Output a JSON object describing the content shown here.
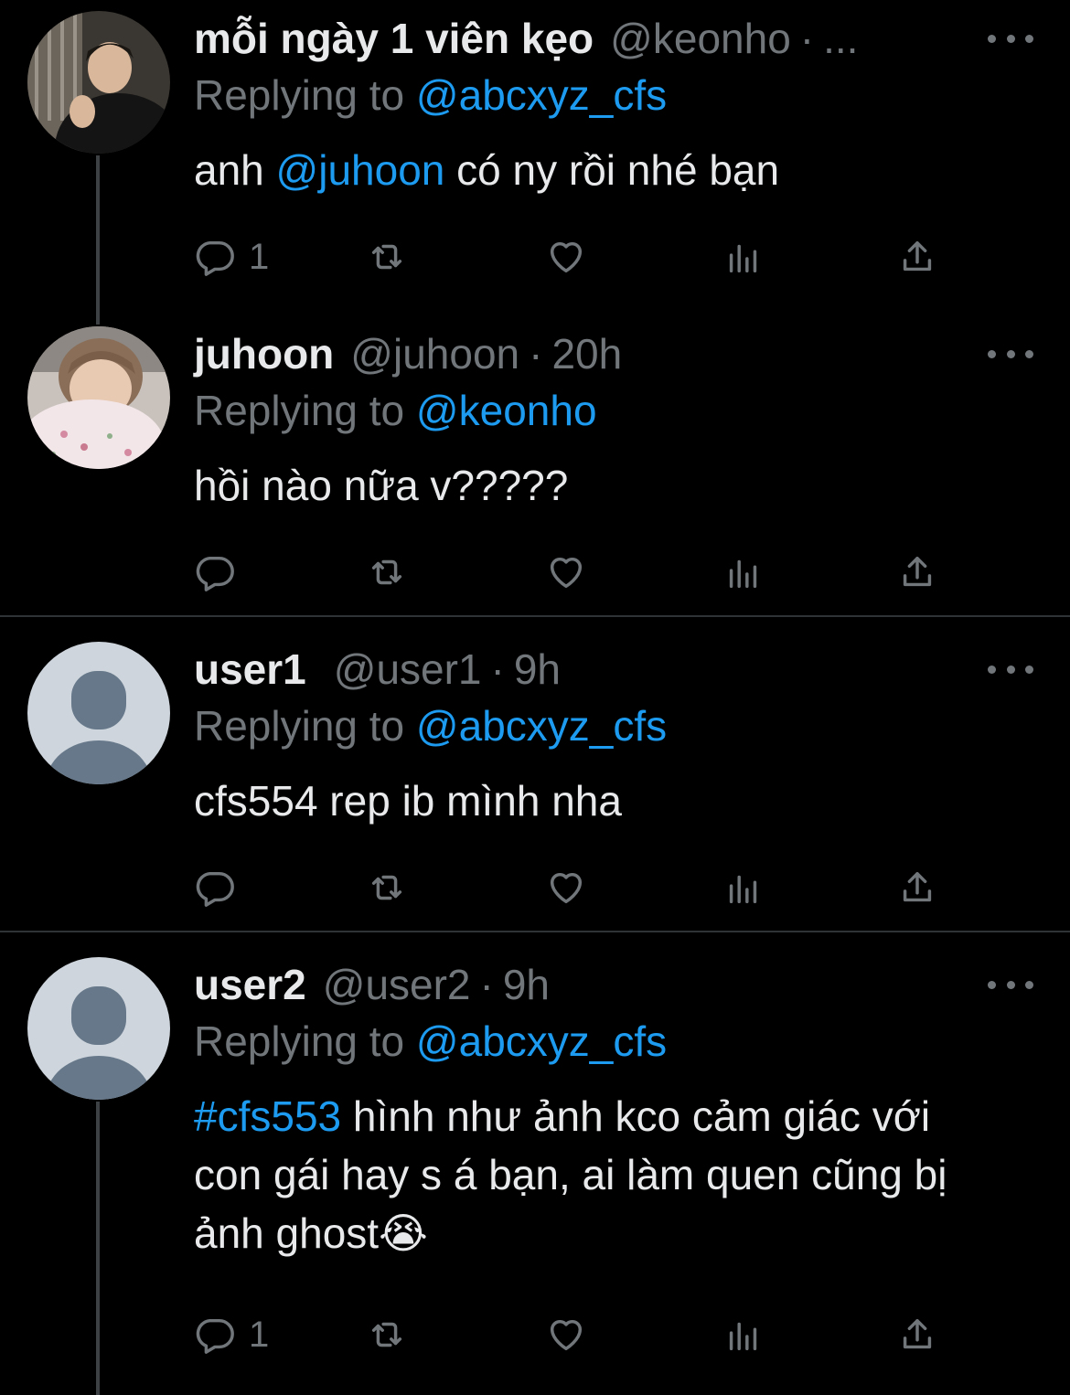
{
  "tweets": [
    {
      "name": "mỗi ngày 1 viên kẹo",
      "handle": "@keonho",
      "separator": "·",
      "time": "...",
      "replying_label": "Replying to",
      "replying_to": "@abcxyz_cfs",
      "body": {
        "prefix": "anh ",
        "mention": "@juhoon",
        "suffix": " có ny rồi nhé bạn"
      },
      "reply_count": "1",
      "avatar": "photo-avatar-keonho"
    },
    {
      "name": "juhoon",
      "handle": "@juhoon",
      "separator": "·",
      "time": "20h",
      "replying_label": "Replying to",
      "replying_to": "@keonho",
      "body": {
        "text": "hồi nào nữa v?????"
      },
      "reply_count": "",
      "avatar": "photo-avatar-juhoon"
    },
    {
      "name": "user1",
      "handle": "@user1",
      "separator": "·",
      "time": "9h",
      "replying_label": "Replying to",
      "replying_to": "@abcxyz_cfs",
      "body": {
        "text": "cfs554 rep ib mình nha"
      },
      "reply_count": "",
      "avatar": "default-avatar"
    },
    {
      "name": "user2",
      "handle": "@user2",
      "separator": "·",
      "time": "9h",
      "replying_label": "Replying to",
      "replying_to": "@abcxyz_cfs",
      "body": {
        "hashtag": "#cfs553",
        "text": " hình như ảnh kco cảm giác với con gái hay s á bạn, ai làm quen cũng bị ảnh ghost",
        "emoji": "😭"
      },
      "reply_count": "1",
      "avatar": "default-avatar"
    }
  ],
  "colors": {
    "background": "#000000",
    "text": "#e7e9ea",
    "muted": "#71767b",
    "link": "#1d9bf0",
    "divider": "#2f3336"
  },
  "icons": [
    "reply-icon",
    "retweet-icon",
    "like-icon",
    "analytics-icon",
    "share-icon",
    "more-icon"
  ]
}
